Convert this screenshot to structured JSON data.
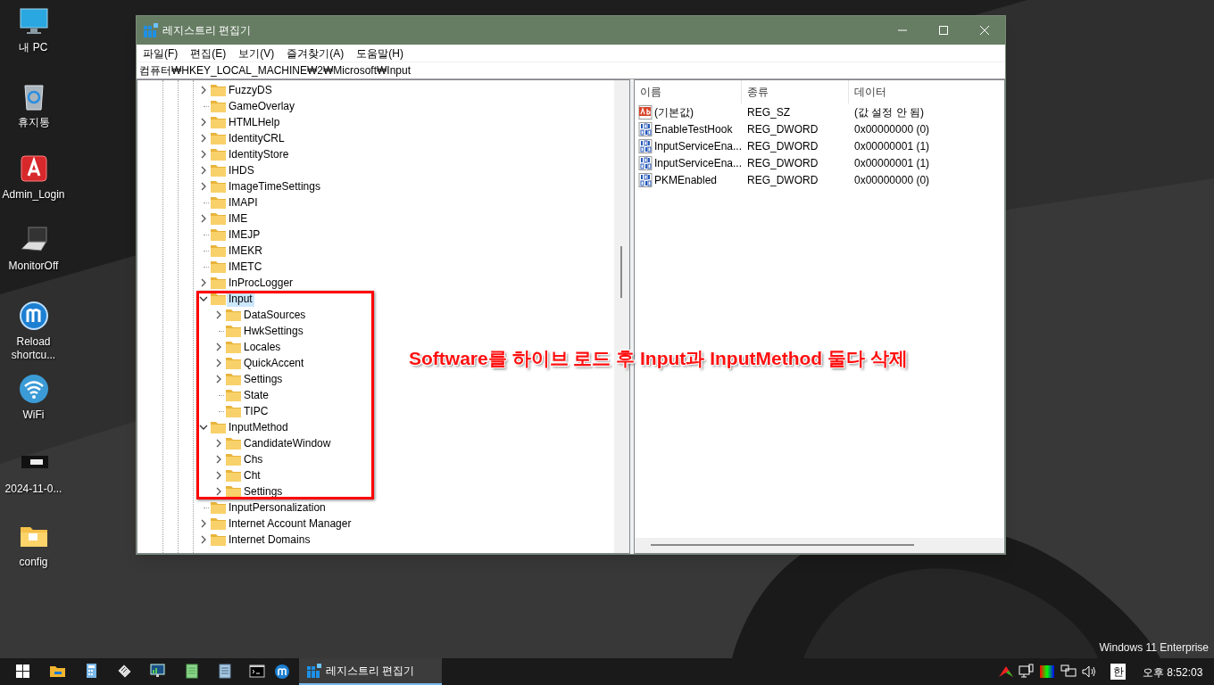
{
  "desktop_icons": [
    {
      "label": "내 PC",
      "kind": "computer"
    },
    {
      "label": "휴지통",
      "kind": "recycle"
    },
    {
      "label": "Admin_Login",
      "kind": "app"
    },
    {
      "label": "MonitorOff",
      "kind": "laptop"
    },
    {
      "label": "Reload shortcu...",
      "kind": "reload"
    },
    {
      "label": "WiFi",
      "kind": "wifi"
    },
    {
      "label": "2024-11-0...",
      "kind": "file"
    },
    {
      "label": "config",
      "kind": "folder"
    }
  ],
  "window": {
    "title": "레지스트리 편집기",
    "menu": [
      "파일(F)",
      "편집(E)",
      "보기(V)",
      "즐겨찾기(A)",
      "도움말(H)"
    ],
    "address": "컴퓨터₩HKEY_LOCAL_MACHINE₩2₩Microsoft₩Input",
    "tree": [
      {
        "name": "FuzzyDS",
        "expandable": true,
        "expanded": false,
        "selected": false
      },
      {
        "name": "GameOverlay",
        "expandable": false,
        "selected": false
      },
      {
        "name": "HTMLHelp",
        "expandable": true,
        "expanded": false,
        "selected": false
      },
      {
        "name": "IdentityCRL",
        "expandable": true,
        "expanded": false,
        "selected": false
      },
      {
        "name": "IdentityStore",
        "expandable": true,
        "expanded": false,
        "selected": false
      },
      {
        "name": "IHDS",
        "expandable": true,
        "expanded": false,
        "selected": false
      },
      {
        "name": "ImageTimeSettings",
        "expandable": true,
        "expanded": false,
        "selected": false
      },
      {
        "name": "IMAPI",
        "expandable": false,
        "selected": false
      },
      {
        "name": "IME",
        "expandable": true,
        "expanded": false,
        "selected": false
      },
      {
        "name": "IMEJP",
        "expandable": false,
        "selected": false
      },
      {
        "name": "IMEKR",
        "expandable": false,
        "selected": false
      },
      {
        "name": "IMETC",
        "expandable": false,
        "selected": false
      },
      {
        "name": "InProcLogger",
        "expandable": true,
        "expanded": false,
        "selected": false
      },
      {
        "name": "Input",
        "expandable": true,
        "expanded": true,
        "selected": true,
        "children": [
          {
            "name": "DataSources",
            "expandable": true,
            "expanded": false,
            "selected": false
          },
          {
            "name": "HwkSettings",
            "expandable": false,
            "selected": false
          },
          {
            "name": "Locales",
            "expandable": true,
            "expanded": false,
            "selected": false
          },
          {
            "name": "QuickAccent",
            "expandable": true,
            "expanded": false,
            "selected": false
          },
          {
            "name": "Settings",
            "expandable": true,
            "expanded": false,
            "selected": false
          },
          {
            "name": "State",
            "expandable": false,
            "selected": false
          },
          {
            "name": "TIPC",
            "expandable": false,
            "selected": false
          }
        ]
      },
      {
        "name": "InputMethod",
        "expandable": true,
        "expanded": true,
        "selected": false,
        "children": [
          {
            "name": "CandidateWindow",
            "expandable": true,
            "expanded": false,
            "selected": false
          },
          {
            "name": "Chs",
            "expandable": true,
            "expanded": false,
            "selected": false
          },
          {
            "name": "Cht",
            "expandable": true,
            "expanded": false,
            "selected": false
          },
          {
            "name": "Settings",
            "expandable": true,
            "expanded": false,
            "selected": false
          }
        ]
      },
      {
        "name": "InputPersonalization",
        "expandable": false,
        "selected": false
      },
      {
        "name": "Internet Account Manager",
        "expandable": true,
        "expanded": false,
        "selected": false
      },
      {
        "name": "Internet Domains",
        "expandable": true,
        "expanded": false,
        "selected": false
      }
    ],
    "columns": [
      "이름",
      "종류",
      "데이터"
    ],
    "values": [
      {
        "kind": "string",
        "name": "(기본값)",
        "type": "REG_SZ",
        "data": "(값 설정 안 됨)"
      },
      {
        "kind": "dword",
        "name": "EnableTestHook",
        "type": "REG_DWORD",
        "data": "0x00000000 (0)"
      },
      {
        "kind": "dword",
        "name": "InputServiceEna...",
        "type": "REG_DWORD",
        "data": "0x00000001 (1)"
      },
      {
        "kind": "dword",
        "name": "InputServiceEna...",
        "type": "REG_DWORD",
        "data": "0x00000001 (1)"
      },
      {
        "kind": "dword",
        "name": "PKMEnabled",
        "type": "REG_DWORD",
        "data": "0x00000000 (0)"
      }
    ]
  },
  "annotation": "Software를 하이브 로드 후 Input과 InputMethod 둘다 삭제",
  "edition": "Windows 11 Enterprise",
  "taskbar": {
    "pinned": [
      {
        "kind": "start"
      },
      {
        "kind": "explorer"
      },
      {
        "kind": "calculator"
      },
      {
        "kind": "tool"
      },
      {
        "kind": "monitor"
      },
      {
        "kind": "notepad-green"
      },
      {
        "kind": "notepad"
      },
      {
        "kind": "terminal"
      },
      {
        "kind": "reload"
      }
    ],
    "task": {
      "title": "레지스트리 편집기",
      "selected": true
    },
    "tray": [
      {
        "kind": "triangle"
      },
      {
        "kind": "network-pc"
      },
      {
        "kind": "color"
      },
      {
        "kind": "network"
      },
      {
        "kind": "volume"
      }
    ],
    "ime": "한",
    "clock": "오후 8:52:03"
  }
}
